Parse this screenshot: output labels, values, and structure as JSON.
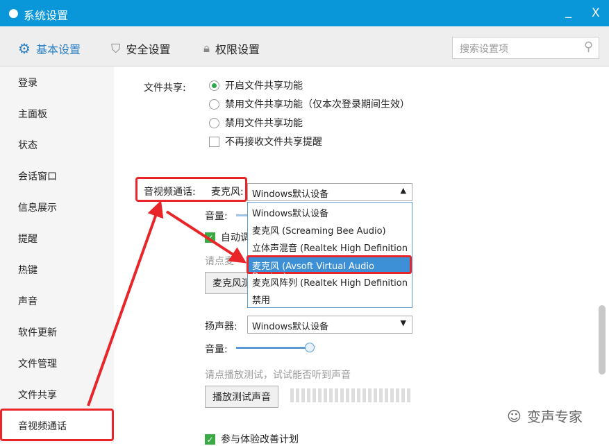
{
  "window": {
    "title": "系统设置",
    "minimize": "_",
    "close": "X"
  },
  "toolbar": {
    "tabs": [
      {
        "label": "基本设置",
        "icon": "gear-icon",
        "active": true
      },
      {
        "label": "安全设置",
        "icon": "shield-icon"
      },
      {
        "label": "权限设置",
        "icon": "lock-icon"
      }
    ],
    "search_placeholder": "搜索设置项"
  },
  "sidebar": {
    "items": [
      "登录",
      "主面板",
      "状态",
      "会话窗口",
      "信息展示",
      "提醒",
      "热键",
      "声音",
      "软件更新",
      "文件管理",
      "文件共享",
      "音视频通话"
    ],
    "selected": "音视频通话"
  },
  "file_share": {
    "label": "文件共享:",
    "options": [
      "开启文件共享功能",
      "禁用文件共享功能（仅本次登录期间生效）",
      "禁用文件共享功能"
    ],
    "selected": 0,
    "checkbox": "不再接收文件共享提醒"
  },
  "av": {
    "label": "音视频通话:",
    "mic_label": "麦克风:",
    "mic_value": "Windows默认设备",
    "mic_options": [
      "Windows默认设备",
      "麦克风 (Screaming Bee Audio)",
      "立体声混音 (Realtek High Definition A",
      "麦克风 (Avsoft Virtual Audio Device)",
      "麦克风阵列 (Realtek High Definition A",
      "禁用"
    ],
    "highlighted_option": 3,
    "volume_label": "音量:",
    "auto_adjust_partial": "自动调",
    "hint_partial": "请点麦",
    "mic_test_partial": "麦克风测",
    "speaker_label": "扬声器:",
    "speaker_value": "Windows默认设备",
    "speaker_volume_label": "音量:",
    "speaker_volume": 1.0,
    "play_hint": "请点播放测试，试试能否听到声音",
    "play_button": "播放测试声音",
    "improve_checkbox": "参与体验改善计划"
  },
  "watermark": "变声专家",
  "colors": {
    "titlebar": "#0a97d9",
    "accent": "#2b7fc4",
    "highlight": "#3d8fd6",
    "annotation": "#e8262a"
  }
}
